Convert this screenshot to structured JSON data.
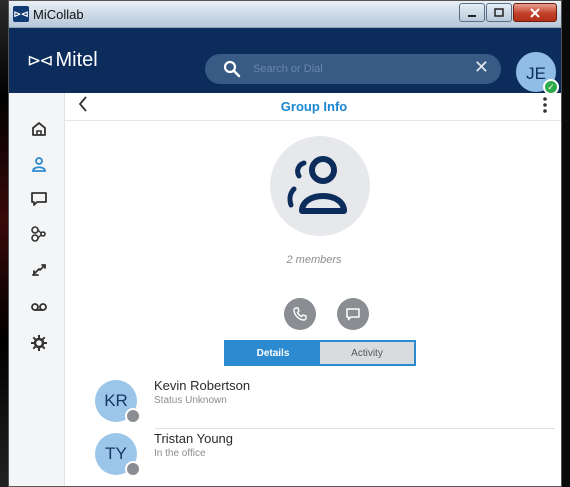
{
  "window": {
    "title": "MiCollab",
    "app_icon": "micollab-icon",
    "controls": [
      "minimize",
      "maximize",
      "close"
    ]
  },
  "appbar": {
    "brand": "Mitel",
    "search_placeholder": "Search or Dial",
    "user_initials": "JE",
    "user_presence": "available",
    "colors": {
      "header": "#0c2c5c",
      "search": "#385b86",
      "accent": "#2c8ad1",
      "presence_ok": "#2faa4a"
    }
  },
  "sidebar": {
    "items": [
      {
        "icon": "home-icon",
        "active": false
      },
      {
        "icon": "contacts-icon",
        "active": true
      },
      {
        "icon": "chat-icon",
        "active": false
      },
      {
        "icon": "groups-icon",
        "active": false
      },
      {
        "icon": "call-history-icon",
        "active": false
      },
      {
        "icon": "voicemail-icon",
        "active": false
      },
      {
        "icon": "settings-icon",
        "active": false
      }
    ]
  },
  "header": {
    "title": "Group Info"
  },
  "group": {
    "members_text": "2 members"
  },
  "actions": [
    {
      "icon": "phone-icon"
    },
    {
      "icon": "chat-icon"
    }
  ],
  "tabs": [
    {
      "label": "Details",
      "active": true
    },
    {
      "label": "Activity",
      "active": false
    }
  ],
  "members": [
    {
      "initials": "KR",
      "name": "Kevin Robertson",
      "status": "Status Unknown"
    },
    {
      "initials": "TY",
      "name": "Tristan Young",
      "status": "In the office"
    }
  ]
}
